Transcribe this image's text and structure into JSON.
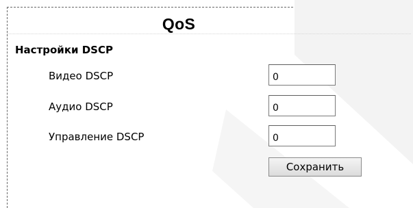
{
  "page": {
    "title": "QoS"
  },
  "dscp": {
    "section_heading": "Настройки DSCP",
    "rows": [
      {
        "label": "Видео DSCP",
        "value": "0"
      },
      {
        "label": "Аудио DSCP",
        "value": "0"
      },
      {
        "label": "Управление DSCP",
        "value": "0"
      }
    ],
    "save_label": "Сохранить"
  },
  "colors": {
    "watermark": "#f2f2f2",
    "frame_border": "#666666"
  }
}
